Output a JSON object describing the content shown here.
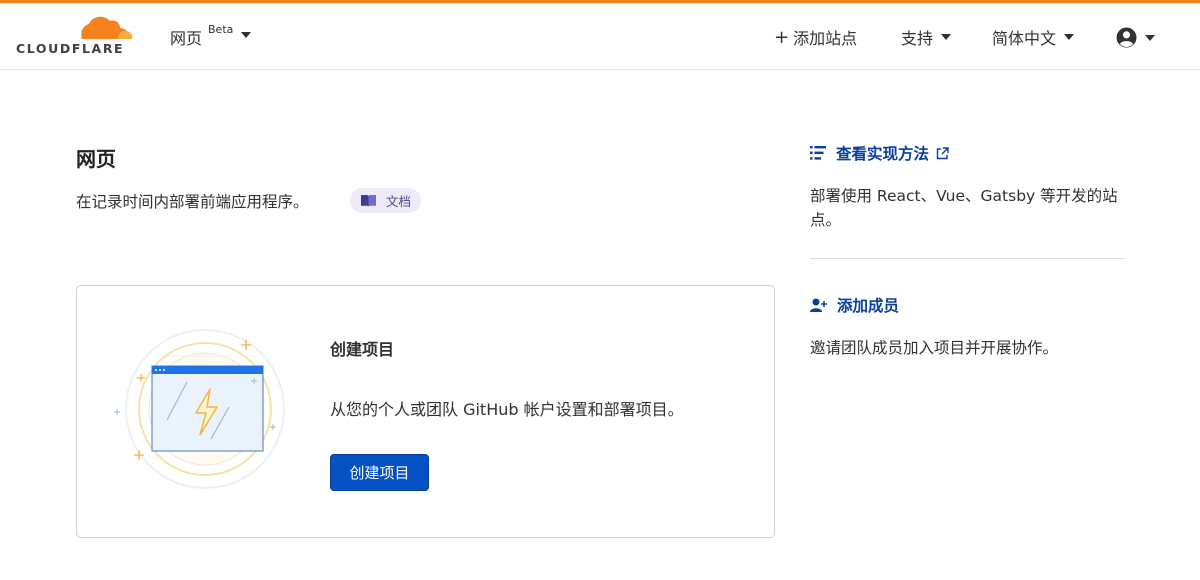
{
  "brand": {
    "logo_text": "CLOUDFLARE",
    "accent_color": "#f6821f",
    "primary_button_color": "#0451c6",
    "link_color": "#0a3e9f"
  },
  "header": {
    "product_name": "网页",
    "product_badge": "Beta",
    "add_site_label": "添加站点",
    "support_label": "支持",
    "language_label": "简体中文",
    "icons": {
      "add": "plus-icon",
      "caret": "caret-down-icon",
      "user": "user-account-icon"
    }
  },
  "page": {
    "title": "网页",
    "description": "在记录时间内部署前端应用程序。",
    "docs_label": "文档",
    "docs_icon": "book-icon"
  },
  "card": {
    "title": "创建项目",
    "description": "从您的个人或团队 GitHub 帐户设置和部署项目。",
    "button_label": "创建项目",
    "illustration_icon": "lightning-browser-illustration"
  },
  "sidebar": {
    "items": [
      {
        "heading": "查看实现方法",
        "icon": "list-icon",
        "external": true,
        "text": "部署使用 React、Vue、Gatsby 等开发的站点。"
      },
      {
        "heading": "添加成员",
        "icon": "add-user-icon",
        "external": false,
        "text": "邀请团队成员加入项目并开展协作。"
      }
    ]
  }
}
